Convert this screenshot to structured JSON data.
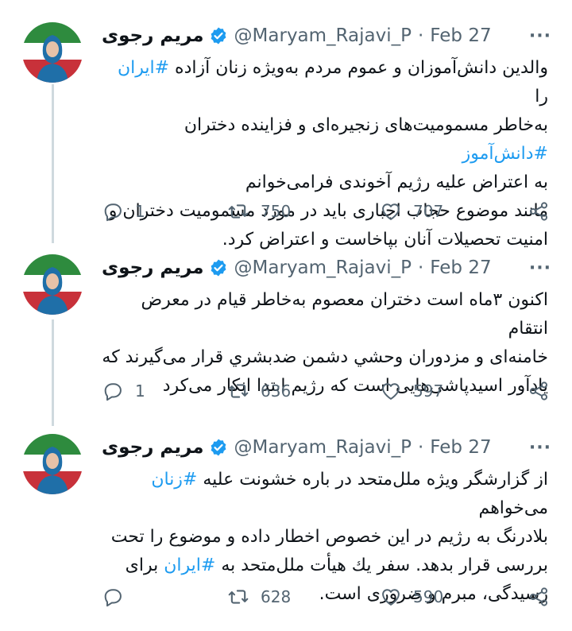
{
  "colors": {
    "accent": "#1d9bf0",
    "muted": "#536471",
    "text": "#0f1419",
    "thread_line": "#cfd9de"
  },
  "tweets": [
    {
      "name": "مریم رجوی",
      "handle": "@Maryam_Rajavi_P",
      "dot": "·",
      "date": "Feb 27",
      "more": "···",
      "line1_a": "والدین دانش‌آموزان و عموم مردم به‌ویژه زنان آزاده ",
      "line1_tag": "#ایران",
      "line1_b": " را",
      "line2_a": "به‌خاطر مسمومیت‌های زنجیره‌ای و فزاینده دختران ",
      "line2_tag": "#دانش‌آموز",
      "line3": "به اعتراض علیه رژیم آخوندی فرامی‌خوانم",
      "line4": "مانند موضوع حجاب اجباری باید در مورد مسمومیت دختران و",
      "line5": "امنیت تحصیلات آنان بپاخاست و اعتراض کرد.",
      "replies": "1",
      "retweets": "750",
      "likes": "707"
    },
    {
      "name": "مریم رجوی",
      "handle": "@Maryam_Rajavi_P",
      "dot": "·",
      "date": "Feb 27",
      "more": "···",
      "line1": "اکنون ۳ماه است دختران معصوم به‌خاطر قیام در معرض انتقام",
      "line2": "خامنه‌ای و مزدوران وحشي دشمن ضدبشري قرار می‌گیرند که",
      "line3": "یادآور اسیدپاشی‌هایی است که رژیم ابتدا انکار می‌کرد",
      "replies": "1",
      "retweets": "636",
      "likes": "597"
    },
    {
      "name": "مریم رجوی",
      "handle": "@Maryam_Rajavi_P",
      "dot": "·",
      "date": "Feb 27",
      "more": "···",
      "line1_a": "از گزارشگر ویژه ملل‌متحد در باره خشونت علیه ",
      "line1_tag": "#زنان",
      "line1_b": " می‌خواهم",
      "line2": "بلادرنگ به رژیم در این خصوص اخطار داده و موضوع را تحت",
      "line3_a": "بررسی قرار بدهد. سفر یك هیأت ملل‌متحد به ",
      "line3_tag": "#ایران",
      "line3_b": " برای",
      "line4": "رسیدگی، مبرم و ضروری است.",
      "replies": "",
      "retweets": "628",
      "likes": "590"
    }
  ]
}
